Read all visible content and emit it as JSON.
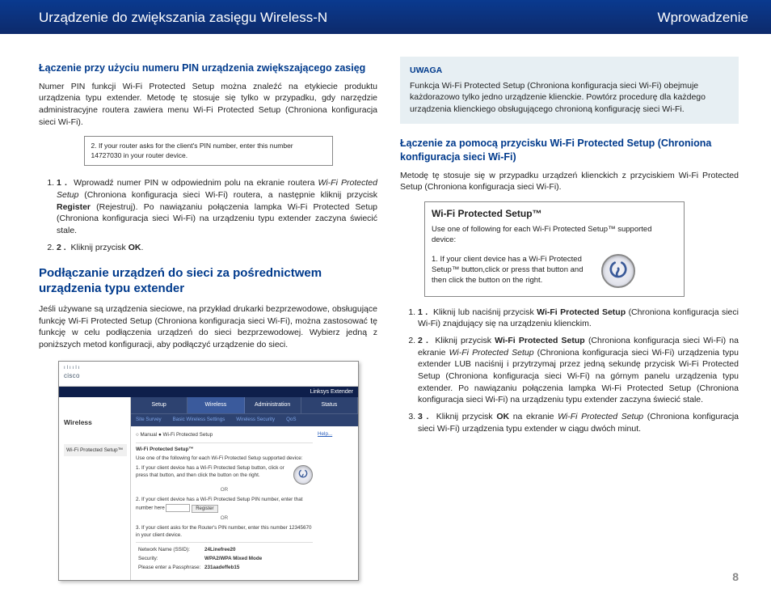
{
  "header": {
    "left": "Urządzenie do zwiększania zasięgu Wireless-N",
    "right": "Wprowadzenie"
  },
  "page_number": "8",
  "left": {
    "h1": "Łączenie przy użyciu numeru PIN urządzenia zwiększającego zasięg",
    "p1": "Numer PIN funkcji Wi-Fi Protected Setup można znaleźć na etykiecie produktu urządzenia typu extender. Metodę tę stosuje się tylko w przypadku, gdy narzędzie administracyjne routera zawiera menu Wi-Fi Protected Setup (Chroniona konfiguracja sieci Wi-Fi).",
    "pin_figure": "2. If your router asks for the client's PIN number, enter this number 14727030 in your router device.",
    "step1_pre": "Wprowadź numer PIN w odpowiednim polu na ekranie routera ",
    "step1_em": "Wi-Fi Protected Setup",
    "step1_post": " (Chroniona konfiguracja sieci Wi-Fi) routera, a następnie kliknij przycisk ",
    "step1_reg": "Register",
    "step1_post2": " (Rejestruj). Po nawiązaniu połączenia lampka Wi-Fi Protected Setup (Chroniona konfiguracja sieci Wi-Fi) na urządzeniu typu extender zaczyna świecić stale.",
    "step2_pre": "Kliknij przycisk ",
    "step2_b": "OK",
    "step2_post": ".",
    "h2": "Podłączanie urządzeń do sieci za pośrednictwem urządzenia typu extender",
    "p2": "Jeśli używane są urządzenia sieciowe, na przykład drukarki bezprzewodowe, obsługujące funkcję Wi-Fi Protected Setup (Chroniona konfiguracja sieci Wi-Fi), można zastosować tę funkcję w celu podłączenia urządzeń do sieci bezprzewodowej. Wybierz jedną z poniższych metod konfiguracji, aby podłączyć urządzenie do sieci."
  },
  "router": {
    "brand": "cisco",
    "product": "Linksys Extender",
    "side_title": "Wireless",
    "side_item": "Wi-Fi Protected Setup™",
    "tabs": [
      "Setup",
      "Wireless",
      "Administration",
      "Status"
    ],
    "subtabs": [
      "Site Survey",
      "Basic Wireless Settings",
      "Wireless Security",
      "QoS"
    ],
    "radio": "○ Manual  ● Wi-Fi Protected Setup",
    "sec_title": "Wi-Fi Protected Setup™",
    "sec_sub": "Use one of the following for each Wi-Fi Protected Setup supported device:",
    "m1": "1. If your client device has a Wi-Fi Protected Setup button, click or press that button, and then click the button on the right.",
    "or": "OR",
    "m2_pre": "2. If your client device has a Wi-Fi Protected Setup PIN number, enter that number here ",
    "m2_btn": "Register",
    "m3": "3. If your client asks for the Router's PIN number, enter this number 12345670 in your client device.",
    "row_ssid_l": "Network Name (SSID):",
    "row_ssid_v": "24Linefree20",
    "row_sec_l": "Security:",
    "row_sec_v": "WPA2/WPA Mixed Mode",
    "row_pass_l": "Please enter a Passphrase:",
    "row_pass_v": "231aadeffeb15",
    "help": "Help..."
  },
  "right": {
    "note_title": "UWAGA",
    "note_body": "Funkcja Wi-Fi Protected Setup (Chroniona konfiguracja sieci Wi-Fi) obejmuje każdorazowo tylko jedno urządzenie klienckie. Powtórz procedurę dla każdego urządzenia klienckiego obsługującego chronioną konfigurację sieci Wi-Fi.",
    "h1": "Łączenie za pomocą przycisku Wi-Fi Protected Setup (Chroniona konfiguracja sieci Wi-Fi)",
    "p1": "Metodę tę stosuje się w przypadku urządzeń klienckich z przyciskiem Wi-Fi Protected Setup (Chroniona konfiguracja sieci Wi-Fi).",
    "wps_title": "Wi-Fi Protected Setup™",
    "wps_sub": "Use one of following for each Wi-Fi Protected Setup™ supported device:",
    "wps_body": "1. If your client device has a Wi-Fi Protected Setup™ button,click or press that button and then click the button on the right.",
    "s1_pre": "Kliknij lub naciśnij przycisk ",
    "s1_b": "Wi-Fi Protected Setup",
    "s1_post": " (Chroniona konfiguracja sieci Wi-Fi) znajdujący się na urządzeniu klienckim.",
    "s2_pre": "Kliknij przycisk ",
    "s2_b": "Wi-Fi Protected Setup",
    "s2_mid": " (Chroniona konfiguracja sieci Wi-Fi) na ekranie ",
    "s2_em": "Wi-Fi Protected Setup",
    "s2_post": " (Chroniona konfiguracja sieci Wi-Fi) urządzenia typu extender LUB naciśnij i przytrzymaj przez jedną sekundę przycisk Wi-Fi Protected Setup (Chroniona konfiguracja sieci Wi-Fi) na górnym panelu urządzenia typu extender. Po nawiązaniu połączenia lampka Wi-Fi Protected Setup (Chroniona konfiguracja sieci Wi-Fi) na urządzeniu typu extender zaczyna świecić stale.",
    "s3_pre": "Kliknij przycisk ",
    "s3_b": "OK",
    "s3_mid": " na ekranie ",
    "s3_em": "Wi-Fi Protected Setup",
    "s3_post": " (Chroniona konfiguracja sieci Wi-Fi) urządzenia typu extender w ciągu dwóch minut."
  }
}
